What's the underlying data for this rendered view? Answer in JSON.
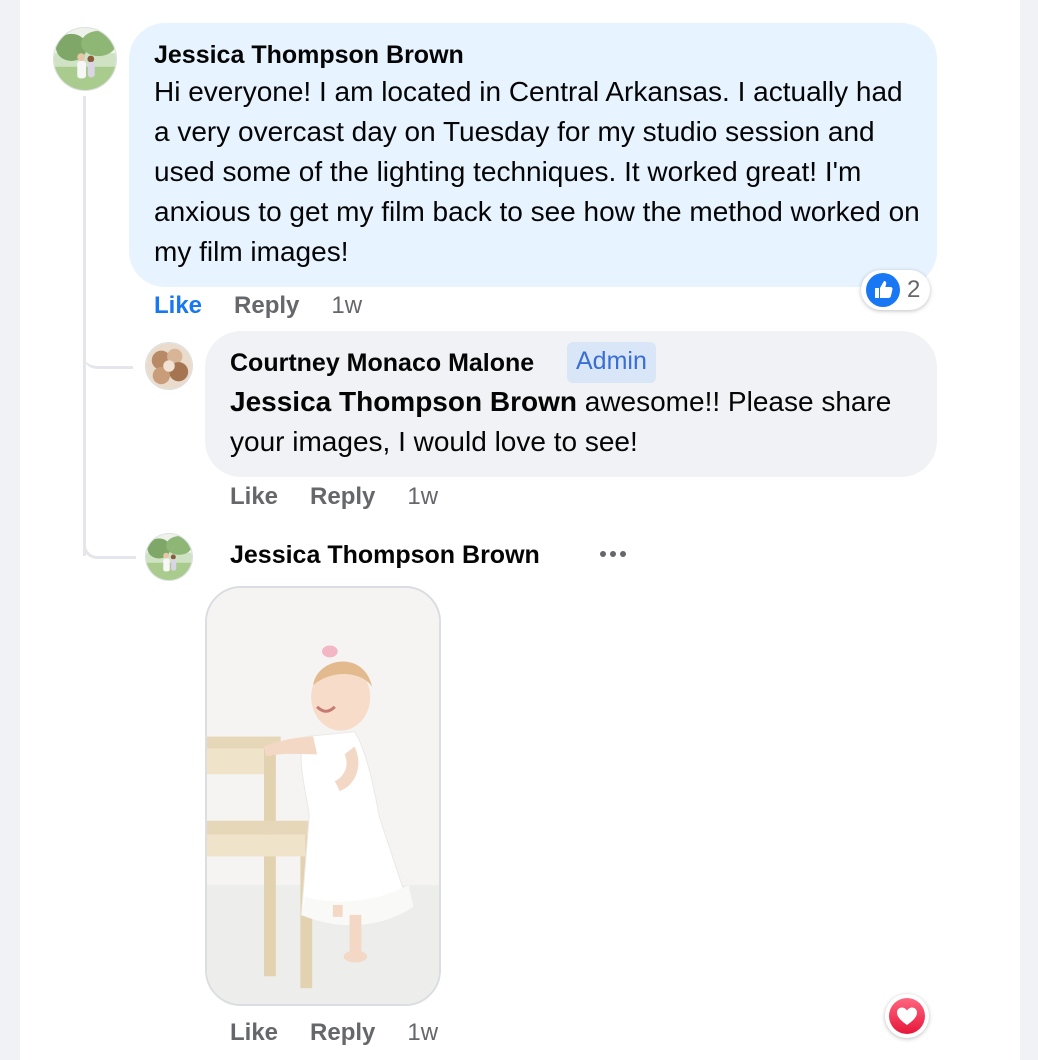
{
  "comments": [
    {
      "author": "Jessica Thompson Brown",
      "text": "Hi everyone! I am located in Central Arkansas. I actually had a very overcast day on Tuesday for my studio session and used some of the lighting techniques. It worked great! I'm anxious to get my film back to see how the method worked on my film images!",
      "actions": {
        "like": "Like",
        "reply": "Reply",
        "time": "1w"
      },
      "reaction": {
        "icon": "like-reaction-icon",
        "count": "2",
        "color": "#1877f2"
      }
    },
    {
      "author": "Courtney Monaco Malone",
      "badge": "Admin",
      "mention": "Jessica Thompson Brown",
      "text": " awesome!! Please share your images, I would love to see!",
      "actions": {
        "like": "Like",
        "reply": "Reply",
        "time": "1w"
      }
    },
    {
      "author": "Jessica Thompson Brown",
      "more_icon": "more-options-icon",
      "attachment": "photo of toddler in white dress standing at wooden step stool",
      "actions": {
        "like": "Like",
        "reply": "Reply",
        "time": "1w"
      },
      "reaction": {
        "icon": "heart-reaction-icon",
        "color": "#f33e58"
      }
    }
  ],
  "colors": {
    "accent_blue": "#1877f2",
    "bubble_blue": "#e7f3ff",
    "bubble_gray": "#f0f2f5",
    "badge_text": "#3b6ed2"
  }
}
